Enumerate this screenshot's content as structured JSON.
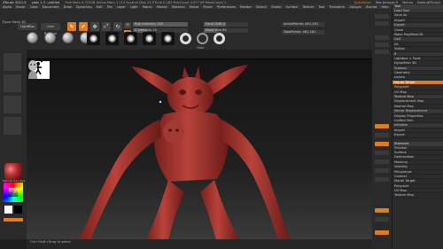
{
  "titlebar": {
    "app": "ZBrush 2021.5",
    "project": "plain 1.5 .untitled",
    "stats": "Free Mem 9.715GB  Active Mem 1.714  Scratch Disk 23  ZTime 0.283  PolyCount 0.977 KP  MeshCount 1",
    "quicksave": "QuickSave",
    "see_through": "See-through 0",
    "menus": "Menus",
    "default_zscript": "DefaultZScript"
  },
  "menubar": [
    "Alpha",
    "Brush",
    "Color",
    "Document",
    "Draw",
    "Dynamics",
    "Edit",
    "File",
    "Layer",
    "Light",
    "Macro",
    "Marker",
    "Material",
    "Movie",
    "Picker",
    "Preferences",
    "Render",
    "Stencil",
    "Stroke",
    "Surface",
    "Texture",
    "Tool",
    "Transform",
    "Zplugin",
    "Zscript",
    "Help"
  ],
  "shelf": {
    "status": "Dyna Mesh 3D",
    "lightbox": "LightBox",
    "live_boolean": "Live Boolean",
    "mode_edit": "Edit",
    "mode_draw": "Draw",
    "mode_move": "Move",
    "mode_scale": "Scale",
    "mode_rotate": "Rotate",
    "mrgb": "Mrgb",
    "rgb": "Rgb",
    "m": "M",
    "zadd": "Zadd",
    "zsub": "Zsub",
    "zcut": "Zcut",
    "rgb_intensity": "Rgb Intensity 100",
    "z_intensity": "Z Intensity 25",
    "focal_shift": "Focal Shift 0",
    "draw_size": "Draw Size 64",
    "dynamic": "Dynamic",
    "active_points": "ActivePoints: 461,281",
    "total_points": "TotalPoints: 461,281",
    "stroke": "Dots",
    "brushes": [
      "Standard",
      "ClayBuildup",
      "Move",
      "DamStandard",
      "Inflate",
      "Pinch",
      "Smooth",
      "TrimDynamic"
    ]
  },
  "left": {
    "material_label": "MatCap Red Wax",
    "gradient": "Gradient",
    "switch_color": "SwitchColor",
    "alternate": "Alternate"
  },
  "viewport": {
    "bottom_text": "Ctrl+Shift+Drag to select"
  },
  "palette": {
    "title": "Tool",
    "items": [
      "Load Tool",
      "Save As",
      "Import",
      "Export",
      "Clone",
      "Make PolyMesh3D",
      "GoZ",
      "All",
      "Visible",
      "R",
      "Lightbox > Tools",
      "DynaMesh 3D",
      "Subtool",
      "Geometry",
      "Layers",
      "Morph Target",
      "Polypaint",
      "UV Map",
      "Texture Map",
      "Displacement Map",
      "Normal Map",
      "Vector Displacement",
      "Display Properties",
      "Unified Skin",
      "Initialize",
      "Import",
      "Export"
    ],
    "subpalette": [
      "Preview",
      "Surface",
      "Deformation",
      "Masking",
      "Visibility",
      "Polygroups",
      "Contact",
      "Morph Target",
      "Polypaint",
      "UV Map",
      "Texture Map"
    ],
    "selected_index": 15
  },
  "colors": {
    "accent": "#e07b20",
    "model": "#a8312c",
    "background": "#1e1e1e"
  }
}
